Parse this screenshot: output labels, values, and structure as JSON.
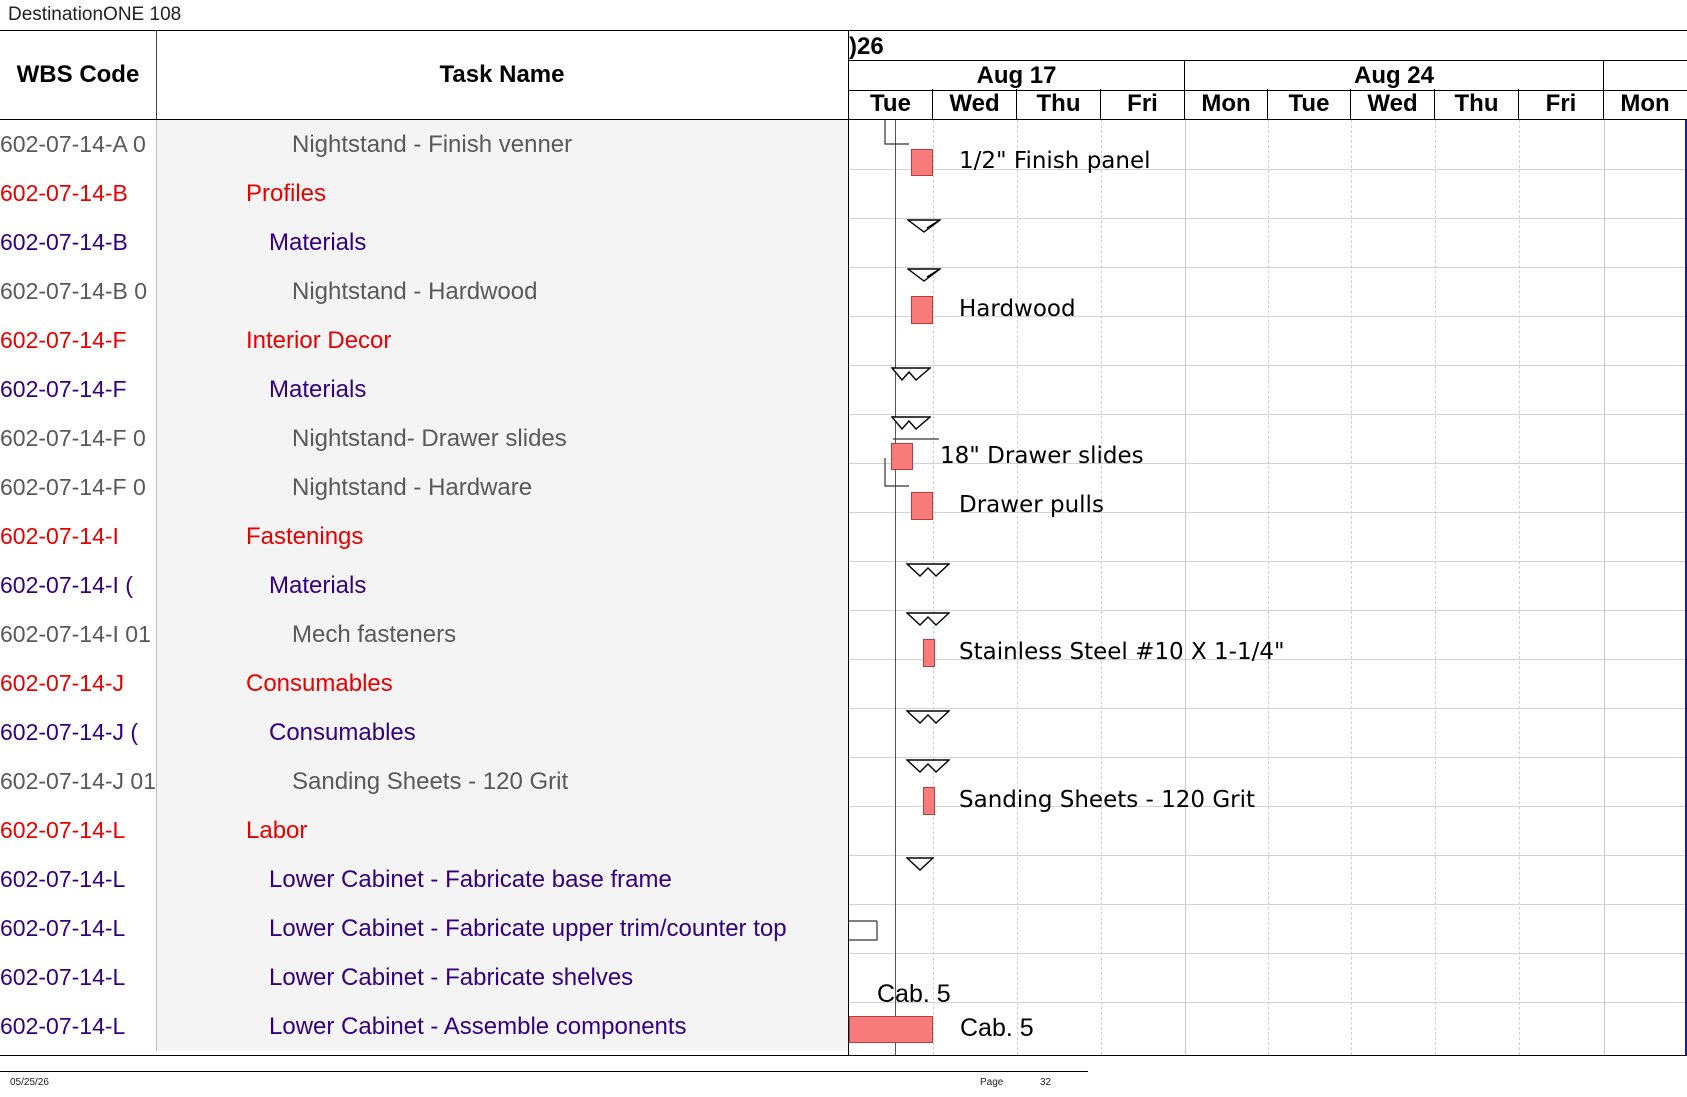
{
  "document_title": "DestinationONE 108",
  "table": {
    "headers": {
      "wbs": "WBS Code",
      "task": "Task Name"
    },
    "rows": [
      {
        "wbs": "602-07-14-A 0",
        "task": "Nightstand - Finish venner",
        "level": "g"
      },
      {
        "wbs": "602-07-14-B",
        "task": "Profiles",
        "level": "r"
      },
      {
        "wbs": "602-07-14-B",
        "task": "Materials",
        "level": "p"
      },
      {
        "wbs": "602-07-14-B 0",
        "task": "Nightstand - Hardwood",
        "level": "g"
      },
      {
        "wbs": "602-07-14-F",
        "task": "Interior Decor",
        "level": "r"
      },
      {
        "wbs": "602-07-14-F",
        "task": "Materials",
        "level": "p"
      },
      {
        "wbs": "602-07-14-F 0",
        "task": "Nightstand- Drawer slides",
        "level": "g"
      },
      {
        "wbs": "602-07-14-F 0",
        "task": "Nightstand - Hardware",
        "level": "g"
      },
      {
        "wbs": "602-07-14-I",
        "task": "Fastenings",
        "level": "r"
      },
      {
        "wbs": "602-07-14-I (",
        "task": "Materials",
        "level": "p"
      },
      {
        "wbs": "602-07-14-I 01",
        "task": "Mech fasteners",
        "level": "g"
      },
      {
        "wbs": "602-07-14-J",
        "task": "Consumables",
        "level": "r"
      },
      {
        "wbs": "602-07-14-J (",
        "task": "Consumables",
        "level": "p"
      },
      {
        "wbs": "602-07-14-J 01",
        "task": "Sanding Sheets - 120 Grit",
        "level": "g"
      },
      {
        "wbs": "602-07-14-L",
        "task": "Labor",
        "level": "r"
      },
      {
        "wbs": "602-07-14-L",
        "task": "Lower Cabinet - Fabricate base frame",
        "level": "p"
      },
      {
        "wbs": "602-07-14-L",
        "task": "Lower Cabinet - Fabricate upper trim/counter top",
        "level": "p"
      },
      {
        "wbs": "602-07-14-L",
        "task": "Lower Cabinet - Fabricate shelves",
        "level": "p"
      },
      {
        "wbs": "602-07-14-L",
        "task": "Lower Cabinet - Assemble components",
        "level": "p"
      }
    ]
  },
  "gantt": {
    "year_fragment": ")26",
    "weeks": [
      {
        "label": "Aug 17"
      },
      {
        "label": "Aug 24"
      }
    ],
    "days": [
      "Tue",
      "Wed",
      "Thu",
      "Fri",
      "Mon",
      "Tue",
      "Wed",
      "Thu",
      "Fri",
      "Mon"
    ],
    "bar_labels": [
      "1/2\" Finish panel",
      "Hardwood",
      "18\" Drawer slides",
      "Drawer pulls",
      "Stainless Steel #10 X 1-1/4\"",
      "Sanding Sheets - 120 Grit",
      "Cab. 5",
      "Cab. 5"
    ],
    "bar_color": "#f77b7b",
    "summary_color": "#000000"
  },
  "footer": {
    "date": "05/25/26",
    "page_label": "Page",
    "page_number": "32"
  }
}
